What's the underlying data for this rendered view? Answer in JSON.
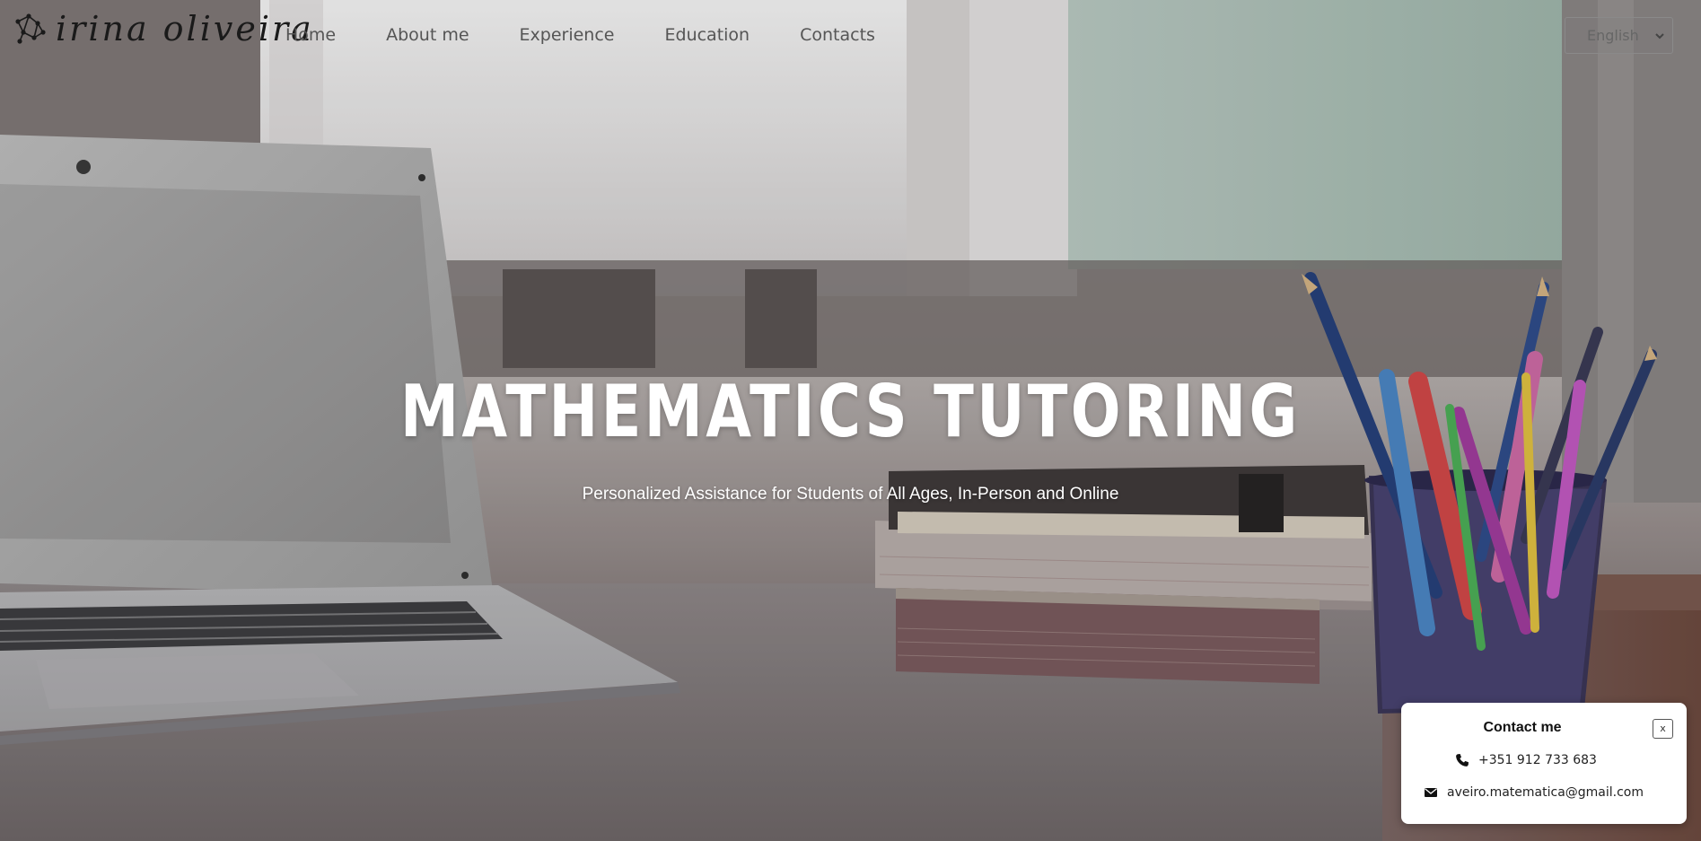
{
  "brand": {
    "name": "irina oliveira",
    "icon": "constellation-logo-icon"
  },
  "nav": {
    "items": [
      {
        "label": "Home"
      },
      {
        "label": "About me"
      },
      {
        "label": "Experience"
      },
      {
        "label": "Education"
      },
      {
        "label": "Contacts"
      }
    ]
  },
  "language": {
    "selected": "English",
    "icon": "chevron-down-icon"
  },
  "hero": {
    "title": "MATHEMATICS TUTORING",
    "subtitle": "Personalized Assistance for Students of All Ages, In-Person and Online",
    "background": "desk-with-laptop-books-pencils-photo"
  },
  "contact_popup": {
    "title": "Contact me",
    "close_label": "x",
    "phone": "+351 912 733 683",
    "phone_icon": "phone-icon",
    "email": "aveiro.matematica@gmail.com",
    "email_icon": "envelope-icon"
  },
  "colors": {
    "nav_text": "#555555",
    "hero_text": "#ffffff",
    "card_bg": "#ffffff"
  }
}
